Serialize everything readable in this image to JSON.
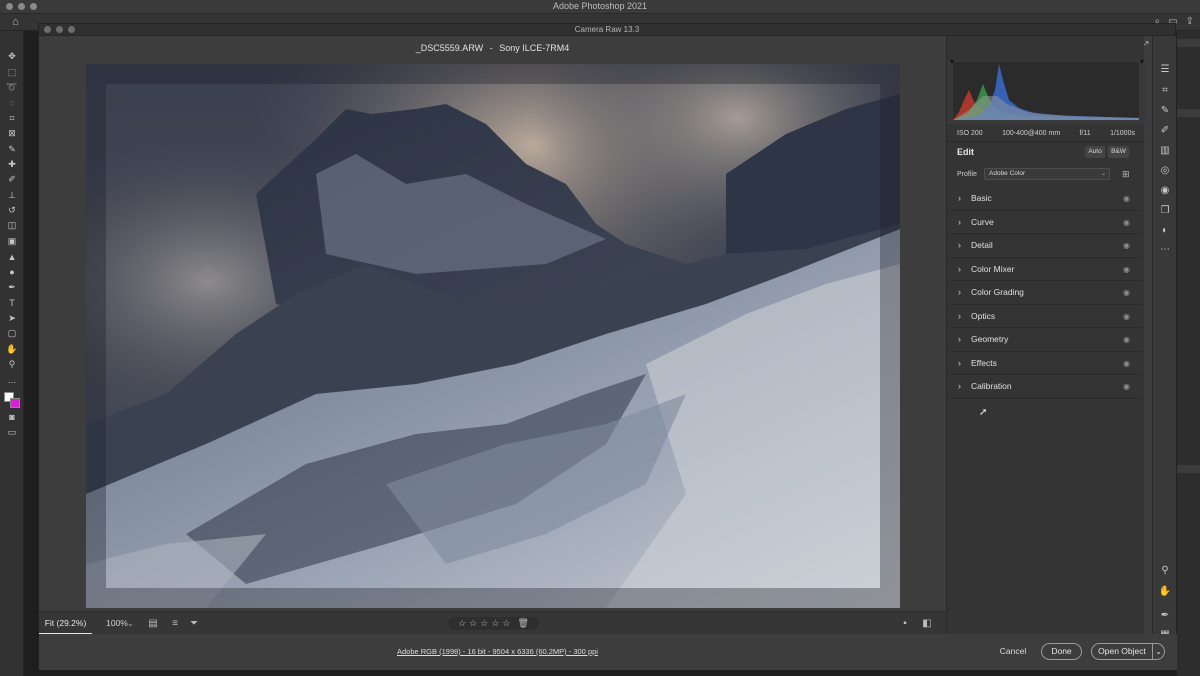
{
  "app": {
    "title": "Adobe Photoshop 2021",
    "camera_raw_title": "Camera Raw 13.3"
  },
  "file": {
    "name": "_DSC5559.ARW",
    "separator": "-",
    "camera": "Sony ILCE-7RM4"
  },
  "histogram_exif": {
    "iso": "ISO 200",
    "lens": "100-400@400 mm",
    "aperture": "f/11",
    "shutter": "1/1000s"
  },
  "edit_panel": {
    "title": "Edit",
    "auto_label": "Auto",
    "bw_label": "B&W",
    "profile_label": "Profile",
    "profile_value": "Adobe Color",
    "sections": [
      {
        "label": "Basic"
      },
      {
        "label": "Curve"
      },
      {
        "label": "Detail"
      },
      {
        "label": "Color Mixer"
      },
      {
        "label": "Color Grading"
      },
      {
        "label": "Optics"
      },
      {
        "label": "Geometry"
      },
      {
        "label": "Effects"
      },
      {
        "label": "Calibration"
      }
    ]
  },
  "bottom_bar": {
    "fit_label": "Fit (29.2%)",
    "zoom_label": "100%",
    "stars": [
      "☆",
      "☆",
      "☆",
      "☆",
      "☆"
    ]
  },
  "footer": {
    "workflow": "Adobe RGB (1998) - 16 bit - 9504 x 6336 (60.2MP) - 300 ppi",
    "cancel": "Cancel",
    "done": "Done",
    "open_object": "Open Object"
  },
  "colors": {
    "foreground": "#ffffff",
    "background": "#d61fd6"
  }
}
